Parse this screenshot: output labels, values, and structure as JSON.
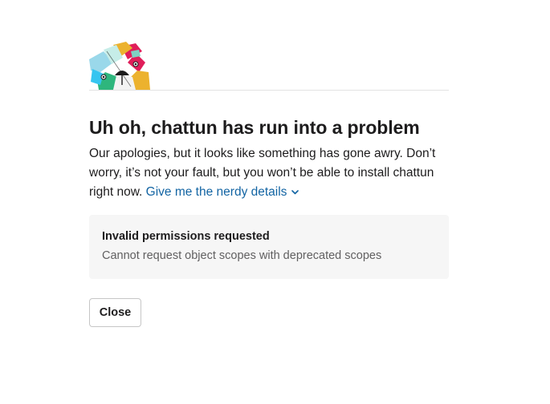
{
  "mascot_icon": "slack-error-mascot-icon",
  "heading": "Uh oh, chattun has run into a problem",
  "description": {
    "text": "Our apologies, but it looks like something has gone awry. Don’t worry, it’s not your fault, but you won’t be able to install chattun right now.",
    "details_link": "Give me the nerdy details",
    "details_icon": "chevron-down-icon"
  },
  "error": {
    "title": "Invalid permissions requested",
    "message": "Cannot request object scopes with deprecated scopes"
  },
  "close_label": "Close",
  "colors": {
    "link": "#1264a3",
    "error_box_bg": "#f6f6f6",
    "text": "#1d1c1d",
    "muted_text": "#616061"
  }
}
